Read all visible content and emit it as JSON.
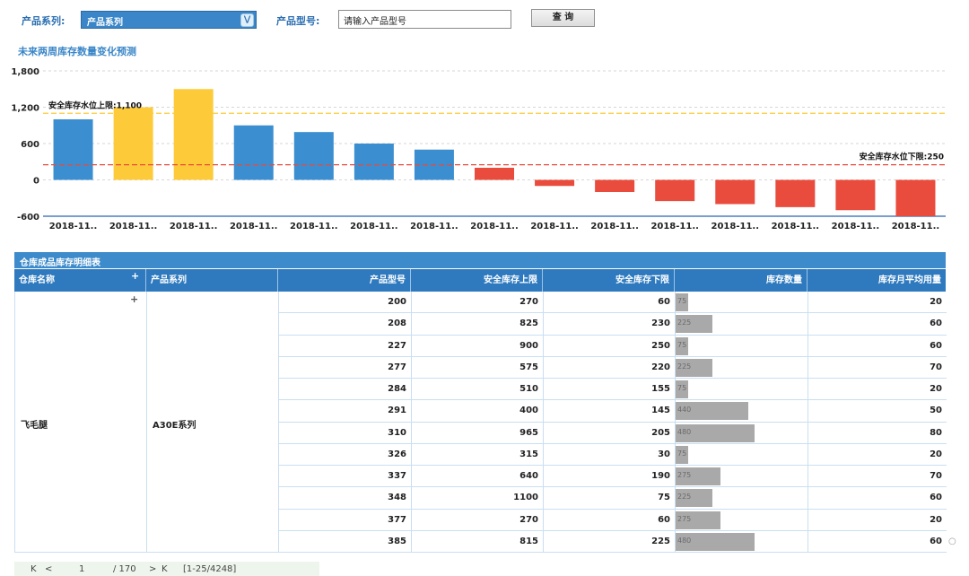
{
  "filters": {
    "series_label": "产品系列:",
    "series_value": "产品系列",
    "model_label": "产品型号:",
    "model_placeholder": "请输入产品型号",
    "query_button": "查 询"
  },
  "chart_data": {
    "type": "bar",
    "title": "未来两周库存数量变化预测",
    "categories": [
      "2018-11..",
      "2018-11..",
      "2018-11..",
      "2018-11..",
      "2018-11..",
      "2018-11..",
      "2018-11..",
      "2018-11..",
      "2018-11..",
      "2018-11..",
      "2018-11..",
      "2018-11..",
      "2018-11..",
      "2018-11..",
      "2018-11.."
    ],
    "values": [
      1000,
      1200,
      1500,
      900,
      790,
      600,
      500,
      200,
      -100,
      -200,
      -350,
      -400,
      -450,
      -500,
      -600
    ],
    "bar_colors": [
      "#3b8ed0",
      "#fdcb3a",
      "#fdcb3a",
      "#3b8ed0",
      "#3b8ed0",
      "#3b8ed0",
      "#3b8ed0",
      "#e94b3c",
      "#e94b3c",
      "#e94b3c",
      "#e94b3c",
      "#e94b3c",
      "#e94b3c",
      "#e94b3c",
      "#e94b3c"
    ],
    "ylim": [
      -600,
      1800
    ],
    "yticks": [
      -600,
      0,
      600,
      1200,
      1800
    ],
    "ytick_labels": [
      "-600",
      "0",
      "600",
      "1,200",
      "1,800"
    ],
    "reference_lines": [
      {
        "label": "安全库存水位上限:1,100",
        "value": 1100,
        "color": "#fdcb3a"
      },
      {
        "label": "安全库存水位下限:250",
        "value": 250,
        "color": "#e94b3c"
      }
    ],
    "grid": true
  },
  "table": {
    "title": "仓库成品库存明细表",
    "headers": [
      "仓库名称",
      "产品系列",
      "产品型号",
      "安全库存上限",
      "安全库存下限",
      "库存数量",
      "库存月平均用量"
    ],
    "warehouse": "飞毛腿",
    "series": "A30E系列",
    "bar_max": 480,
    "rows": [
      {
        "model": "200",
        "upper": "270",
        "lower": "60",
        "stock": 75,
        "stock_label": "75",
        "avg": "20"
      },
      {
        "model": "208",
        "upper": "825",
        "lower": "230",
        "stock": 225,
        "stock_label": "225",
        "avg": "60"
      },
      {
        "model": "227",
        "upper": "900",
        "lower": "250",
        "stock": 75,
        "stock_label": "75",
        "avg": "60"
      },
      {
        "model": "277",
        "upper": "575",
        "lower": "220",
        "stock": 225,
        "stock_label": "225",
        "avg": "70"
      },
      {
        "model": "284",
        "upper": "510",
        "lower": "155",
        "stock": 75,
        "stock_label": "75",
        "avg": "20"
      },
      {
        "model": "291",
        "upper": "400",
        "lower": "145",
        "stock": 440,
        "stock_label": "440",
        "avg": "50"
      },
      {
        "model": "310",
        "upper": "965",
        "lower": "205",
        "stock": 480,
        "stock_label": "480",
        "avg": "80"
      },
      {
        "model": "326",
        "upper": "315",
        "lower": "30",
        "stock": 75,
        "stock_label": "75",
        "avg": "20"
      },
      {
        "model": "337",
        "upper": "640",
        "lower": "190",
        "stock": 275,
        "stock_label": "275",
        "avg": "70"
      },
      {
        "model": "348",
        "upper": "1100",
        "lower": "75",
        "stock": 225,
        "stock_label": "225",
        "avg": "60"
      },
      {
        "model": "377",
        "upper": "270",
        "lower": "60",
        "stock": 275,
        "stock_label": "275",
        "avg": "20"
      },
      {
        "model": "385",
        "upper": "815",
        "lower": "225",
        "stock": 480,
        "stock_label": "480",
        "avg": "60"
      }
    ]
  },
  "pager": {
    "first": "K",
    "prev": "<",
    "page": "1",
    "total": "/ 170",
    "next": ">",
    "last": "K",
    "range": "[1-25/4248]"
  }
}
